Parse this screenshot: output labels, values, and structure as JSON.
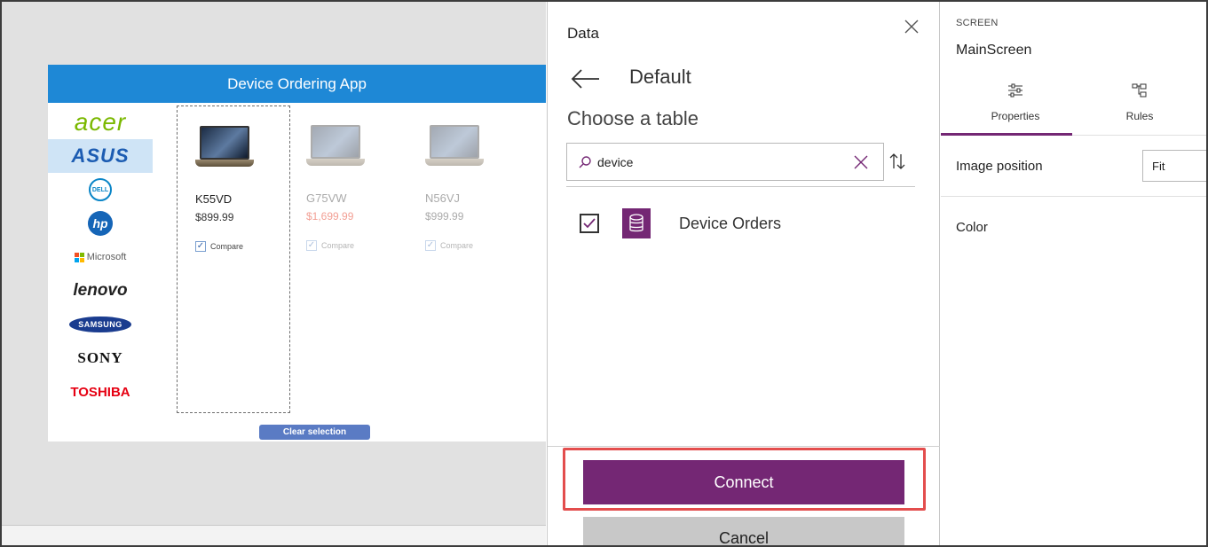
{
  "app": {
    "title": "Device Ordering App",
    "brands": [
      {
        "name": "acer",
        "icon": "acer-logo"
      },
      {
        "name": "ASUS",
        "icon": "asus-logo"
      },
      {
        "name": "DELL",
        "icon": "dell-logo"
      },
      {
        "name": "hp",
        "icon": "hp-logo"
      },
      {
        "name": "Microsoft",
        "icon": "microsoft-logo"
      },
      {
        "name": "lenovo",
        "icon": "lenovo-logo"
      },
      {
        "name": "SAMSUNG",
        "icon": "samsung-logo"
      },
      {
        "name": "SONY",
        "icon": "sony-logo"
      },
      {
        "name": "TOSHIBA",
        "icon": "toshiba-logo"
      }
    ],
    "selected_brand": "ASUS",
    "products": [
      {
        "name": "K55VD",
        "price": "$899.99",
        "compare_label": "Compare",
        "checked": true
      },
      {
        "name": "G75VW",
        "price": "$1,699.99",
        "compare_label": "Compare",
        "checked": true
      },
      {
        "name": "N56VJ",
        "price": "$999.99",
        "compare_label": "Compare",
        "checked": true
      }
    ],
    "clear_label": "Clear selection",
    "colors": {
      "header": "#1e88d6",
      "accent": "#742774",
      "price_alert": "#f29f94"
    }
  },
  "data_panel": {
    "title": "Data",
    "close_icon": "close-icon",
    "back_icon": "back-arrow-icon",
    "source_name": "Default",
    "choose_label": "Choose a table",
    "search_value": "device",
    "search_icon": "search-icon",
    "clear_icon": "clear-icon",
    "sort_icon": "sort-icon",
    "tables": [
      {
        "name": "Device Orders",
        "checked": true,
        "icon": "database-icon"
      }
    ],
    "connect_label": "Connect",
    "cancel_label": "Cancel"
  },
  "properties": {
    "section_label": "SCREEN",
    "screen_name": "MainScreen",
    "tabs": [
      {
        "label": "Properties",
        "icon": "properties-icon",
        "active": true
      },
      {
        "label": "Rules",
        "icon": "rules-icon",
        "active": false
      }
    ],
    "image_position_label": "Image position",
    "image_position_value": "Fit",
    "color_label": "Color"
  }
}
